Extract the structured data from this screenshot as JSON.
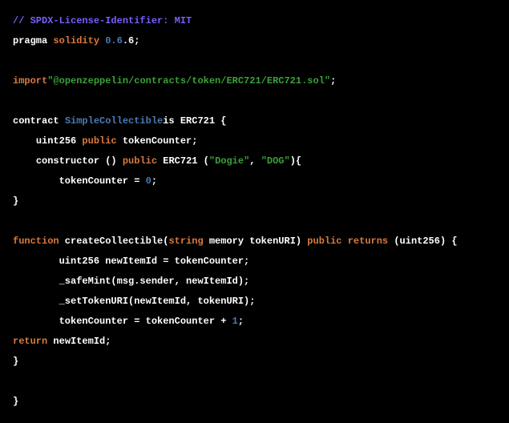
{
  "code": {
    "l1_comment": "// SPDX-License-Identifier: MIT",
    "l2_pragma": "pragma",
    "l2_solidity": " solidity ",
    "l2_ver_a": "0.6",
    "l2_ver_b": ".6;",
    "l3_import": "import",
    "l3_string": "\"@openzeppelin/contracts/token/ERC721/ERC721.sol\"",
    "l3_semi": ";",
    "l4_contract": "contract ",
    "l4_name": "SimpleCollectible",
    "l4_is": "is ",
    "l4_erc": "ERC721 {",
    "l5_indent": "    ",
    "l5_uint": "uint256 ",
    "l5_public": "public",
    "l5_ident": " tokenCounter;",
    "l6_indent": "    ",
    "l6_ctor": "constructor () ",
    "l6_public": "public",
    "l6_erc": " ERC721 (",
    "l6_str1": "\"Dogie\"",
    "l6_comma": ", ",
    "l6_str2": "\"DOG\"",
    "l6_close": "){",
    "l7_indent": "        ",
    "l7_assign": "tokenCounter = ",
    "l7_zero": "0",
    "l7_semi": ";",
    "l8_close": "}",
    "l9_fn": "function",
    "l9_name": " createCollectible(",
    "l9_str": "string",
    "l9_mem": " memory",
    "l9_param": " tokenURI) ",
    "l9_pub": "public",
    "l9_sp": " ",
    "l9_ret": "returns",
    "l9_rp": " (uint256) {",
    "l10_indent": "        ",
    "l10_body": "uint256 newItemId = tokenCounter;",
    "l11_indent": "        ",
    "l11_body": "_safeMint(msg.sender, newItemId);",
    "l12_indent": "        ",
    "l12_body": "_setTokenURI(newItemId, tokenURI);",
    "l13_indent": "        ",
    "l13_a": "tokenCounter = tokenCounter + ",
    "l13_n": "1",
    "l13_s": ";",
    "l14_ret": "return",
    "l14_id": " newItemId;",
    "l15_close": "}",
    "l16_close": "}"
  }
}
